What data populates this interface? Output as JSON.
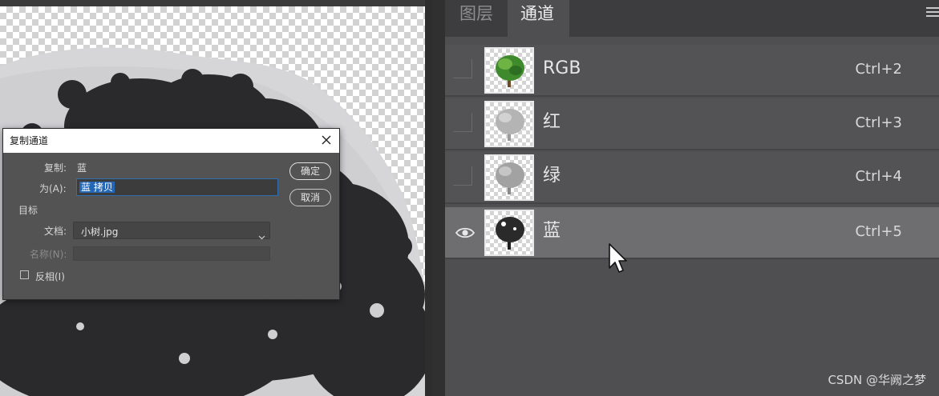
{
  "panel": {
    "tabs": [
      {
        "label": "图层",
        "active": false
      },
      {
        "label": "通道",
        "active": true
      }
    ],
    "menu_icon": "hamburger-menu-icon",
    "channels": [
      {
        "name": "RGB",
        "shortcut": "Ctrl+2",
        "visible": false,
        "selected": false,
        "thumb": "color-tree"
      },
      {
        "name": "红",
        "shortcut": "Ctrl+3",
        "visible": false,
        "selected": false,
        "thumb": "light-gray-tree"
      },
      {
        "name": "绿",
        "shortcut": "Ctrl+4",
        "visible": false,
        "selected": false,
        "thumb": "gray-tree"
      },
      {
        "name": "蓝",
        "shortcut": "Ctrl+5",
        "visible": true,
        "selected": true,
        "thumb": "dark-tree"
      }
    ]
  },
  "dialog": {
    "title": "复制通道",
    "source_label": "复制:",
    "source_value": "蓝",
    "as_label": "为(A):",
    "as_value": "蓝 拷贝",
    "destination_heading": "目标",
    "document_label": "文档:",
    "document_value": "小树.jpg",
    "name_label": "名称(N):",
    "name_value": "",
    "invert_label": "反相(I)",
    "invert_checked": false,
    "ok_label": "确定",
    "cancel_label": "取消"
  },
  "watermark": "CSDN @华阙之梦",
  "colors": {
    "panel_bg": "#4f4f52",
    "row_selected": "#6e6e71",
    "selection_blue": "#2467b5",
    "dialog_bg": "#535353"
  }
}
